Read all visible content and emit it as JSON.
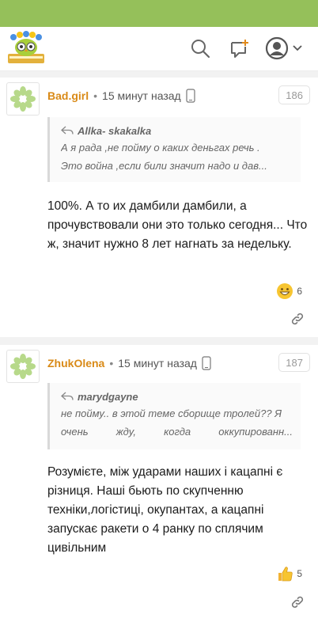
{
  "colors": {
    "accent": "#95c05a",
    "author": "#d98a17"
  },
  "header": {
    "logo_icon": "owl-with-books-logo",
    "search_icon": "search-icon",
    "new_topic_icon": "add-comment-icon",
    "user_icon": "user-avatar-icon"
  },
  "comments": [
    {
      "author": "Bad.girl",
      "time": "15 минут назад",
      "device_icon": "mobile-phone-icon",
      "number": "186",
      "quote": {
        "author": "Allka- skakalka",
        "lines": [
          "А я рада ,не пойму о каких деньгах речь .",
          "Это война ,если били значит надо и дав..."
        ]
      },
      "text": "100%. А то их дамбили дамбили, а прочувствовали они это только сегодня... Что ж, значит нужно 8 лет нагнать за недельку.",
      "reaction": {
        "icon": "grinning-face-emoji",
        "count": "6"
      }
    },
    {
      "author": "ZhukOlena",
      "time": "15 минут назад",
      "device_icon": "mobile-phone-icon",
      "number": "187",
      "quote": {
        "author": "marydgayne",
        "lines": [
          "не пойму.. в этой теме сборище тролей?? Я",
          "очень жду, когда оккупированн..."
        ]
      },
      "text": "Розумієте, між ударами наших і кацапні є різниця. Наші бьють по скупченню техніки,логістиці, окупантах, а кацапні запускає ракети о 4 ранку по сплячим цивільним",
      "reaction": {
        "icon": "thumbs-up-emoji",
        "count": "5"
      }
    }
  ]
}
